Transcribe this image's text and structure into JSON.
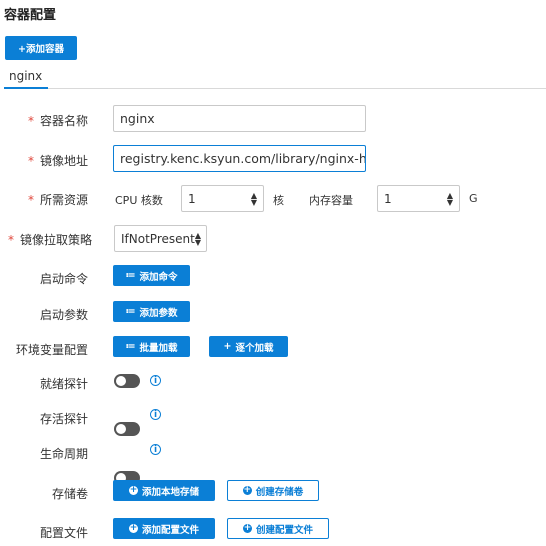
{
  "page": {
    "title": "容器配置",
    "add_container": "+添加容器"
  },
  "tabs": [
    {
      "label": "nginx"
    }
  ],
  "form": {
    "name": {
      "label": "容器名称",
      "value": "nginx"
    },
    "image": {
      "label": "镜像地址",
      "value": "registry.kenc.ksyun.com/library/nginx-hellc"
    },
    "resources": {
      "label": "所需资源",
      "cpu_label": "CPU 核数",
      "cpu_value": "1",
      "cpu_unit": "核",
      "mem_label": "内存容量",
      "mem_value": "1",
      "mem_unit": "G"
    },
    "pull_policy": {
      "label": "镜像拉取策略",
      "value": "IfNotPresent"
    },
    "command": {
      "label": "启动命令",
      "button": "添加命令"
    },
    "args": {
      "label": "启动参数",
      "button": "添加参数"
    },
    "env": {
      "label": "环境变量配置",
      "batch_button": "批量加载",
      "single_button": "逐个加载"
    },
    "readiness": {
      "label": "就绪探针"
    },
    "liveness": {
      "label": "存活探针"
    },
    "lifecycle": {
      "label": "生命周期"
    },
    "volumes": {
      "label": "存储卷",
      "add_button": "添加本地存储",
      "create_button": "创建存储卷"
    },
    "configs": {
      "label": "配置文件",
      "add_button": "添加配置文件",
      "create_button": "创建配置文件"
    }
  },
  "colors": {
    "primary": "#0b7fd6",
    "required": "#e0473c",
    "toggle_off": "#555555"
  }
}
